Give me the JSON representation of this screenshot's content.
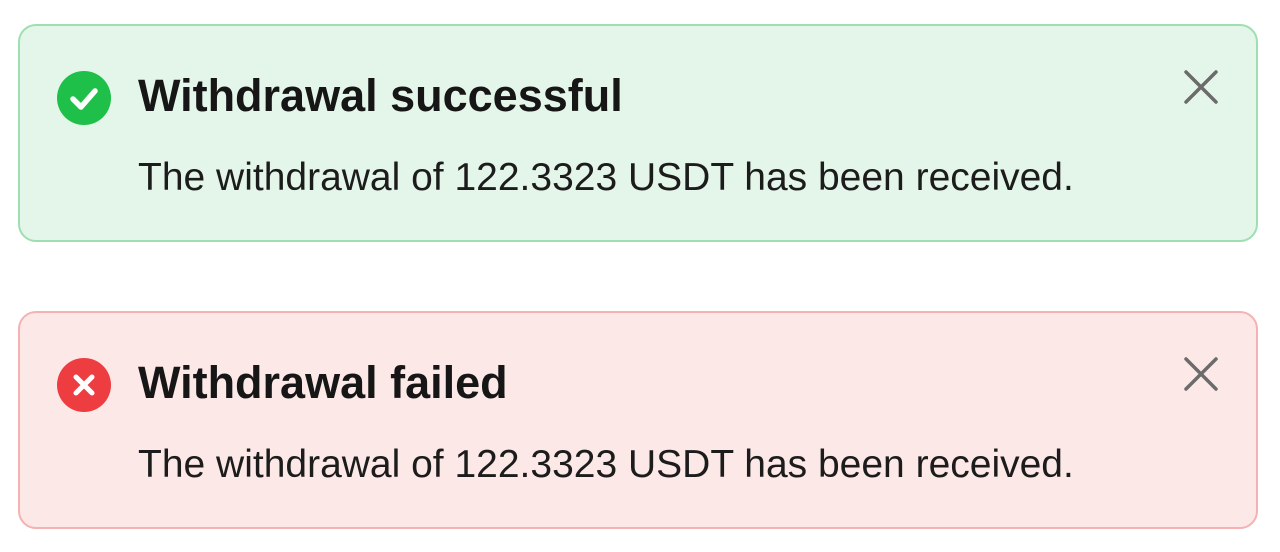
{
  "theme": {
    "success_bg": "#e4f6ea",
    "success_border": "#9ddfb0",
    "success_icon": "#1ec04a",
    "error_bg": "#fde8e8",
    "error_border": "#f4b2b2",
    "error_icon": "#ee3d41",
    "close_icon": "#6b6b6b"
  },
  "toasts": [
    {
      "variant": "success",
      "icon": "check-circle-icon",
      "title": "Withdrawal successful",
      "message": "The withdrawal of 122.3323 USDT has been received.",
      "close_icon": "close-icon"
    },
    {
      "variant": "error",
      "icon": "x-circle-icon",
      "title": "Withdrawal failed",
      "message": "The withdrawal of 122.3323 USDT has been received.",
      "close_icon": "close-icon"
    }
  ]
}
